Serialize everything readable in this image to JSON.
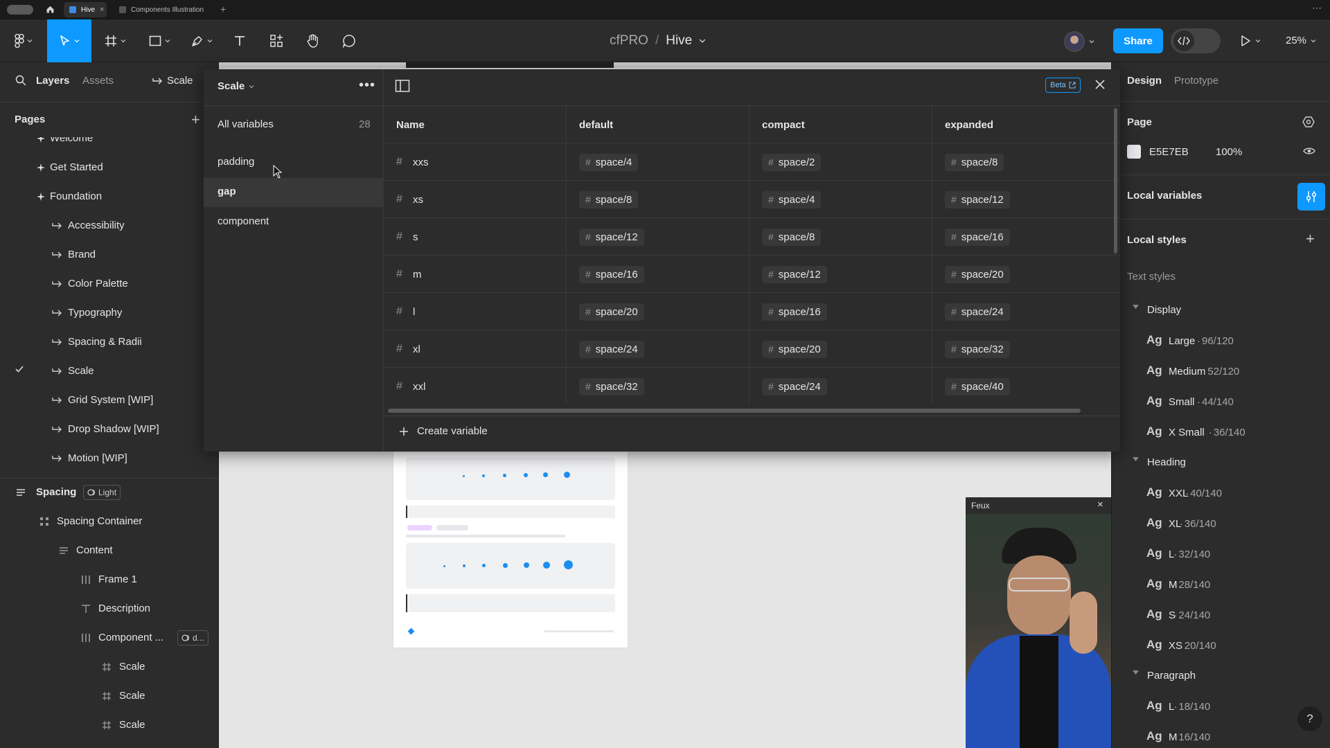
{
  "browser_tabs": [
    {
      "label": "Hive",
      "active": true
    },
    {
      "label": "Components Illustration",
      "active": false
    }
  ],
  "toolbar": {
    "breadcrumb_team": "cfPRO",
    "breadcrumb_sep": "/",
    "file_name": "Hive",
    "share_label": "Share",
    "zoom": "25%"
  },
  "left_panel": {
    "tabs": [
      "Layers",
      "Assets"
    ],
    "scale_link": "Scale",
    "pages_header": "Pages",
    "pages": [
      {
        "label": "Welcome",
        "icon": "star"
      },
      {
        "label": "Get Started",
        "icon": "star"
      },
      {
        "label": "Foundation",
        "icon": "star"
      },
      {
        "label": "Accessibility",
        "icon": "link"
      },
      {
        "label": "Brand",
        "icon": "link"
      },
      {
        "label": "Color Palette",
        "icon": "link"
      },
      {
        "label": "Typography",
        "icon": "link"
      },
      {
        "label": "Spacing & Radii",
        "icon": "link"
      },
      {
        "label": "Scale",
        "icon": "link",
        "checked": true
      },
      {
        "label": "Grid System [WIP]",
        "icon": "link"
      },
      {
        "label": "Drop Shadow [WIP]",
        "icon": "link"
      },
      {
        "label": "Motion [WIP]",
        "icon": "link"
      }
    ],
    "layers_root": {
      "label": "Spacing",
      "mode": "Light"
    },
    "layers": [
      {
        "label": "Spacing Container",
        "icon": "grid"
      },
      {
        "label": "Content",
        "icon": "lines"
      },
      {
        "label": "Frame 1",
        "icon": "bars"
      },
      {
        "label": "Description",
        "icon": "text"
      },
      {
        "label": "Component ...",
        "icon": "bars",
        "badge": "d..."
      },
      {
        "label": "Scale",
        "icon": "hash"
      },
      {
        "label": "Scale",
        "icon": "hash"
      },
      {
        "label": "Scale",
        "icon": "hash"
      }
    ]
  },
  "variables_modal": {
    "collection": "Scale",
    "beta": "Beta",
    "groups_all_label": "All variables",
    "groups_all_count": "28",
    "groups": [
      "padding",
      "gap",
      "component"
    ],
    "selected_group": "gap",
    "columns": [
      "Name",
      "default",
      "compact",
      "expanded"
    ],
    "rows": [
      {
        "name": "xxs",
        "default": "space/4",
        "compact": "space/2",
        "expanded": "space/8"
      },
      {
        "name": "xs",
        "default": "space/8",
        "compact": "space/4",
        "expanded": "space/12"
      },
      {
        "name": "s",
        "default": "space/12",
        "compact": "space/8",
        "expanded": "space/16"
      },
      {
        "name": "m",
        "default": "space/16",
        "compact": "space/12",
        "expanded": "space/20"
      },
      {
        "name": "l",
        "default": "space/20",
        "compact": "space/16",
        "expanded": "space/24"
      },
      {
        "name": "xl",
        "default": "space/24",
        "compact": "space/20",
        "expanded": "space/32"
      },
      {
        "name": "xxl",
        "default": "space/32",
        "compact": "space/24",
        "expanded": "space/40"
      }
    ],
    "create_label": "Create variable"
  },
  "video_overlay": {
    "title": "Feux"
  },
  "right_panel": {
    "tabs": [
      "Design",
      "Prototype"
    ],
    "page_header": "Page",
    "page_color": "E5E7EB",
    "page_opacity": "100%",
    "local_variables": "Local variables",
    "local_styles": "Local styles",
    "text_styles": "Text styles",
    "ag": "Ag",
    "groups": [
      {
        "label": "Display",
        "items": [
          {
            "name": "Large",
            "size": "96/120"
          },
          {
            "name": "Medium",
            "size": "52/120"
          },
          {
            "name": "Small",
            "size": "44/140"
          },
          {
            "name": "X Small",
            "size": "36/140"
          }
        ]
      },
      {
        "label": "Heading",
        "items": [
          {
            "name": "XXL",
            "size": "40/140"
          },
          {
            "name": "XL",
            "size": "36/140"
          },
          {
            "name": "L",
            "size": "32/140"
          },
          {
            "name": "M",
            "size": "28/140"
          },
          {
            "name": "S",
            "size": "24/140"
          },
          {
            "name": "XS",
            "size": "20/140"
          }
        ]
      },
      {
        "label": "Paragraph",
        "items": [
          {
            "name": "L",
            "size": "18/140"
          },
          {
            "name": "M",
            "size": "16/140"
          }
        ]
      }
    ],
    "help": "?"
  },
  "colors": {
    "accent": "#0d99ff",
    "canvas": "#e5e5e5",
    "panel": "#2c2c2c"
  }
}
